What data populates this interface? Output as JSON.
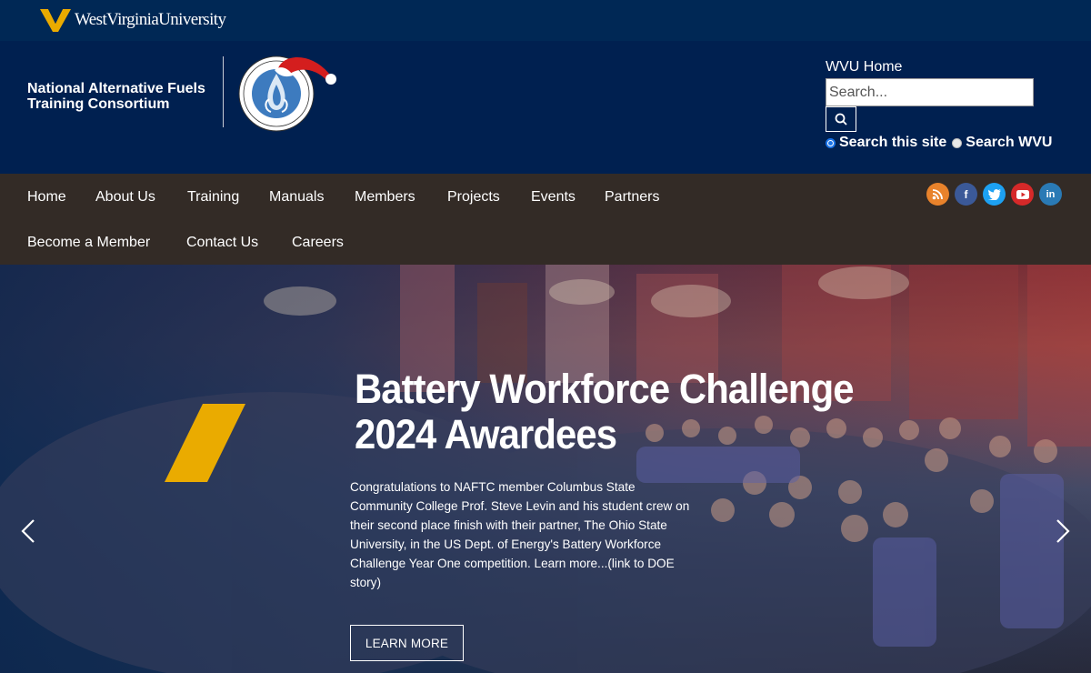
{
  "top_bar": {
    "university_wordmark": "WestVirginiaUniversity"
  },
  "header": {
    "site_name_line1": "National Alternative Fuels",
    "site_name_line2": "Training Consortium",
    "seal_text": "NATIONAL ALTERNATIVE FUELS TRAINING CONSORTIUM",
    "wvu_home_label": "WVU Home",
    "search": {
      "placeholder": "Search...",
      "value": "",
      "scopes": [
        {
          "label": "Search this site",
          "selected": true
        },
        {
          "label": "Search WVU",
          "selected": false
        }
      ]
    }
  },
  "nav": {
    "row1": [
      "Home",
      "About Us",
      "Training",
      "Manuals",
      "Members",
      "Projects",
      "Events",
      "Partners"
    ],
    "row2": [
      "Become a Member",
      "Contact Us",
      "Careers"
    ]
  },
  "social": [
    {
      "icon": "rss-icon",
      "color": "#e8822b"
    },
    {
      "icon": "facebook-icon",
      "color": "#3b5998"
    },
    {
      "icon": "twitter-icon",
      "color": "#1da1f2"
    },
    {
      "icon": "youtube-icon",
      "color": "#d62929"
    },
    {
      "icon": "linkedin-icon",
      "color": "#2a7ab5"
    }
  ],
  "hero": {
    "title_line1": "Battery Workforce Challenge",
    "title_line2": "2024 Awardees",
    "body": "Congratulations to NAFTC member Columbus State Community College Prof. Steve Levin and his student crew on their second place finish with their partner, The Ohio State University, in the US Dept. of Energy's Battery Workforce Challenge Year One competition. Learn more...(link to DOE story)",
    "button_label": "LEARN MORE",
    "accent_color": "#eaab00"
  }
}
